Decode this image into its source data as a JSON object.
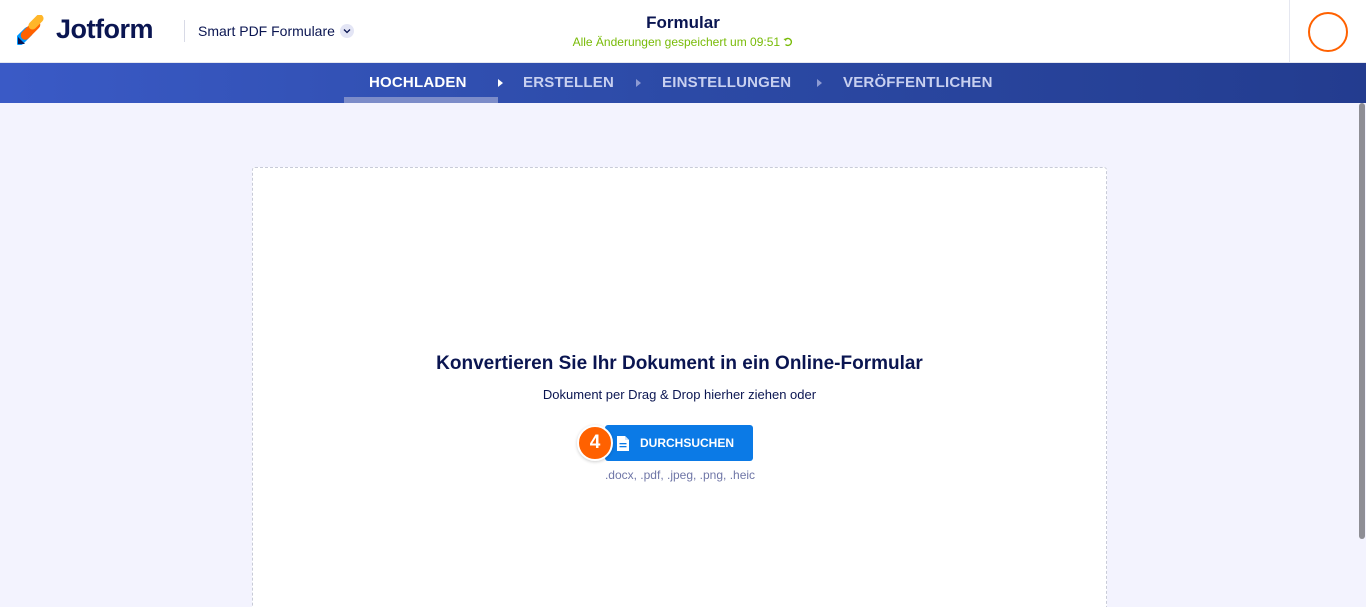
{
  "header": {
    "brand": "Jotform",
    "product": "Smart PDF Formulare",
    "form_title": "Formular",
    "save_status": "Alle Änderungen gespeichert um 09:51"
  },
  "nav": {
    "steps": [
      "HOCHLADEN",
      "ERSTELLEN",
      "EINSTELLUNGEN",
      "VERÖFFENTLICHEN"
    ],
    "active_step": "HOCHLADEN"
  },
  "upload": {
    "heading": "Konvertieren Sie Ihr Dokument in ein Online-Formular",
    "subtitle": "Dokument per Drag & Drop hierher ziehen oder",
    "browse_label": "DURCHSUCHEN",
    "formats": ".docx, .pdf, .jpeg, .png, .heic",
    "step_badge": "4"
  },
  "colors": {
    "brand_navy": "#0a1551",
    "accent_orange": "#ff6100",
    "primary_blue": "#0b7ae6",
    "status_green": "#78bb07"
  },
  "icons": [
    "jotform-logo-icon",
    "chevron-down-icon",
    "undo-icon",
    "nav-arrow-icon",
    "document-icon"
  ]
}
